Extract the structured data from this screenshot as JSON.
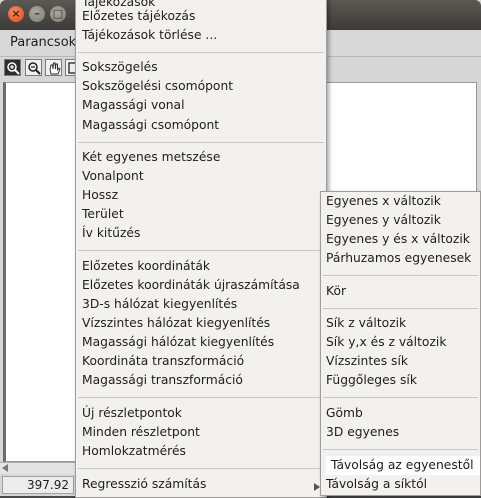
{
  "window": {
    "close_glyph": "×",
    "min_glyph": "–",
    "max_glyph": "□"
  },
  "menubar": {
    "parancsok": "Parancsok"
  },
  "toolbar": {
    "icons": [
      "zoom-in-icon",
      "zoom-out-icon",
      "pan-hand-icon",
      "zoom-extent-icon"
    ]
  },
  "status": {
    "coordinate": "397.92"
  },
  "main_menu": {
    "items": [
      "Tájékozások",
      "Előzetes tájékozás",
      "Tájékozások törlése ...",
      "Sokszögelés",
      "Sokszögelési csomópont",
      "Magassági vonal",
      "Magassági csomópont",
      "Két egyenes metszése",
      "Vonalpont",
      "Hossz",
      "Terület",
      "Ív kitűzés",
      "Előzetes koordináták",
      "Előzetes koordináták újraszámítása",
      "3D-s hálózat kiegyenlítés",
      "Vízszintes hálózat kiegyenlítés",
      "Magassági hálózat kiegyenlítés",
      "Koordináta transzformáció",
      "Magassági transzformáció",
      "Új részletpontok",
      "Minden részletpont",
      "Homlokzatmérés",
      "Regresszió számítás"
    ]
  },
  "sub_menu": {
    "items": [
      "Egyenes x változik",
      "Egyenes y változik",
      "Egyenes y és x változik",
      "Párhuzamos egyenesek",
      "Kör",
      "Sík z változik",
      "Sík y,x és z változik",
      "Vízszintes sík",
      "Függőleges sík",
      "Gömb",
      "3D egyenes",
      "Távolság az egyenestől",
      "Távolság a síktól"
    ]
  },
  "colors": {
    "highlight": "#ffffff",
    "menu_bg": "#f2f1f0",
    "titlebar": "#3c3b37",
    "close": "#df4a16"
  }
}
